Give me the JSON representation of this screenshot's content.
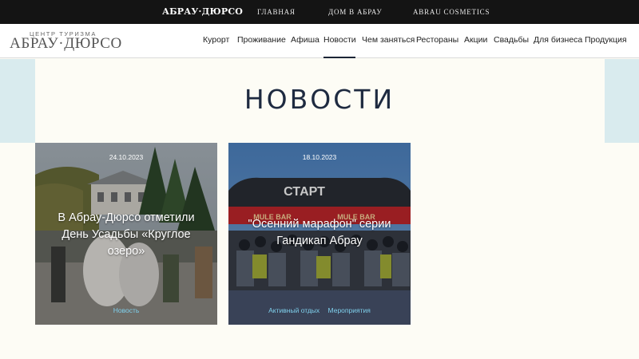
{
  "topbar": {
    "brand": "АБРАУ·ДЮРСО",
    "links": [
      "ГЛАВНАЯ",
      "ДОМ В АБРАУ",
      "ABRAU COSMETICS"
    ]
  },
  "header": {
    "logo_sub": "ЦЕНТР ТУРИЗМА",
    "logo_main": "АБРАУ·ДЮРСО",
    "nav": [
      "Курорт",
      "Проживание",
      "Афиша",
      "Новости",
      "Чем заняться",
      "Рестораны",
      "Акции",
      "Свадьбы",
      "Для бизнеса",
      "Продукция"
    ],
    "active_nav": "Новости"
  },
  "page": {
    "title": "НОВОСТИ"
  },
  "cards": [
    {
      "date": "24.10.2023",
      "title": "В Абрау-Дюрсо отметили День Усадьбы «Круглое озеро»",
      "tags": [
        "Новость"
      ]
    },
    {
      "date": "18.10.2023",
      "title": "\"Осенний марафон\" серии Гандикап Абрау",
      "tags": [
        "Активный отдых",
        "Мероприятия"
      ],
      "banner_text": "СТАРТ",
      "sponsor_text": "MULE BAR"
    }
  ],
  "colors": {
    "topbar_bg": "#141414",
    "accent_dark": "#1e2a40",
    "band": "#d9ebee",
    "tag": "#7fd0ec",
    "page_bg": "#fdfcf5"
  }
}
